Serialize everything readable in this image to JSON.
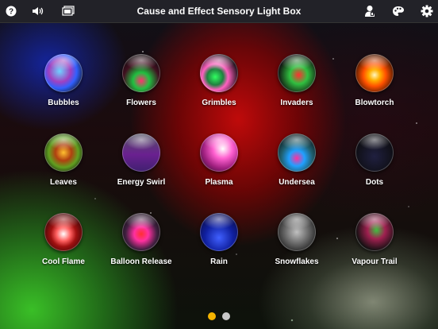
{
  "app": {
    "title": "Cause and Effect Sensory Light Box"
  },
  "toolbar": {
    "left_icons": [
      "help-icon",
      "volume-icon",
      "display-icon"
    ],
    "right_icons": [
      "person-icon",
      "palette-icon",
      "gear-icon"
    ]
  },
  "tiles": [
    {
      "label": "Bubbles",
      "orb": "radial-gradient(circle at 40% 45%, #6fd3ff, #a040c0 35%, #3060ff 55%, #111 85%)"
    },
    {
      "label": "Flowers",
      "orb": "radial-gradient(circle at 50% 70%, #ff3070 0%, #20c040 25%, #401020 55%, #0a0a0a 85%)"
    },
    {
      "label": "Grimbles",
      "orb": "radial-gradient(circle at 40% 60%, #30ff60 0%, #208040 25%, #ff60c0 40%, #0a0a0a 75%)"
    },
    {
      "label": "Invaders",
      "orb": "radial-gradient(circle at 55% 55%, #ff3030 0%, #30c040 30%, #101010 70%)"
    },
    {
      "label": "Blowtorch",
      "orb": "radial-gradient(circle at 50% 55%, #fff6c0 0%, #ffb000 20%, #ff5000 40%, #1a0800 80%)"
    },
    {
      "label": "Leaves",
      "orb": "radial-gradient(circle at 50% 50%, #ffc030 0%, #b04010 30%, #60a020 55%, #101010 85%)"
    },
    {
      "label": "Energy Swirl",
      "orb": "linear-gradient(180deg, #505060 0%, #6a2090 55%, #402070 100%)"
    },
    {
      "label": "Plasma",
      "orb": "radial-gradient(circle at 60% 40%, #ffffff 0%, #ff60d0 30%, #a02080 60%, #301030 90%)"
    },
    {
      "label": "Undersea",
      "orb": "radial-gradient(circle at 50% 65%, #ff30a0 0%, #20a0ff 25%, #206070 50%, #0a0a0a 85%)"
    },
    {
      "label": "Dots",
      "orb": "radial-gradient(circle at 50% 60%, #202040 0%, #101018 60%, #050505 100%)"
    },
    {
      "label": "Cool Flame",
      "orb": "radial-gradient(circle at 50% 55%, #ffffff 0%, #ff6060 25%, #a01010 45%, #1a0505 85%)"
    },
    {
      "label": "Balloon Release",
      "orb": "radial-gradient(circle at 50% 55%, #ff3030 0%, #ff30a0 25%, #402040 55%, #0a0a0a 85%)"
    },
    {
      "label": "Rain",
      "orb": "radial-gradient(circle at 50% 65%, #4060ff 0%, #1020a0 45%, #0a0a40 85%)"
    },
    {
      "label": "Snowflakes",
      "orb": "radial-gradient(circle at 50% 50%, #c0c0c0 0%, #707070 40%, #202020 80%)"
    },
    {
      "label": "Vapour Trail",
      "orb": "radial-gradient(circle at 55% 45%, #40c040 0%, #a02050 30%, #101010 70%)"
    }
  ],
  "pager": {
    "pages": 2,
    "active_index": 0,
    "active_color": "#f5b400",
    "inactive_color": "#c8c8c8"
  }
}
